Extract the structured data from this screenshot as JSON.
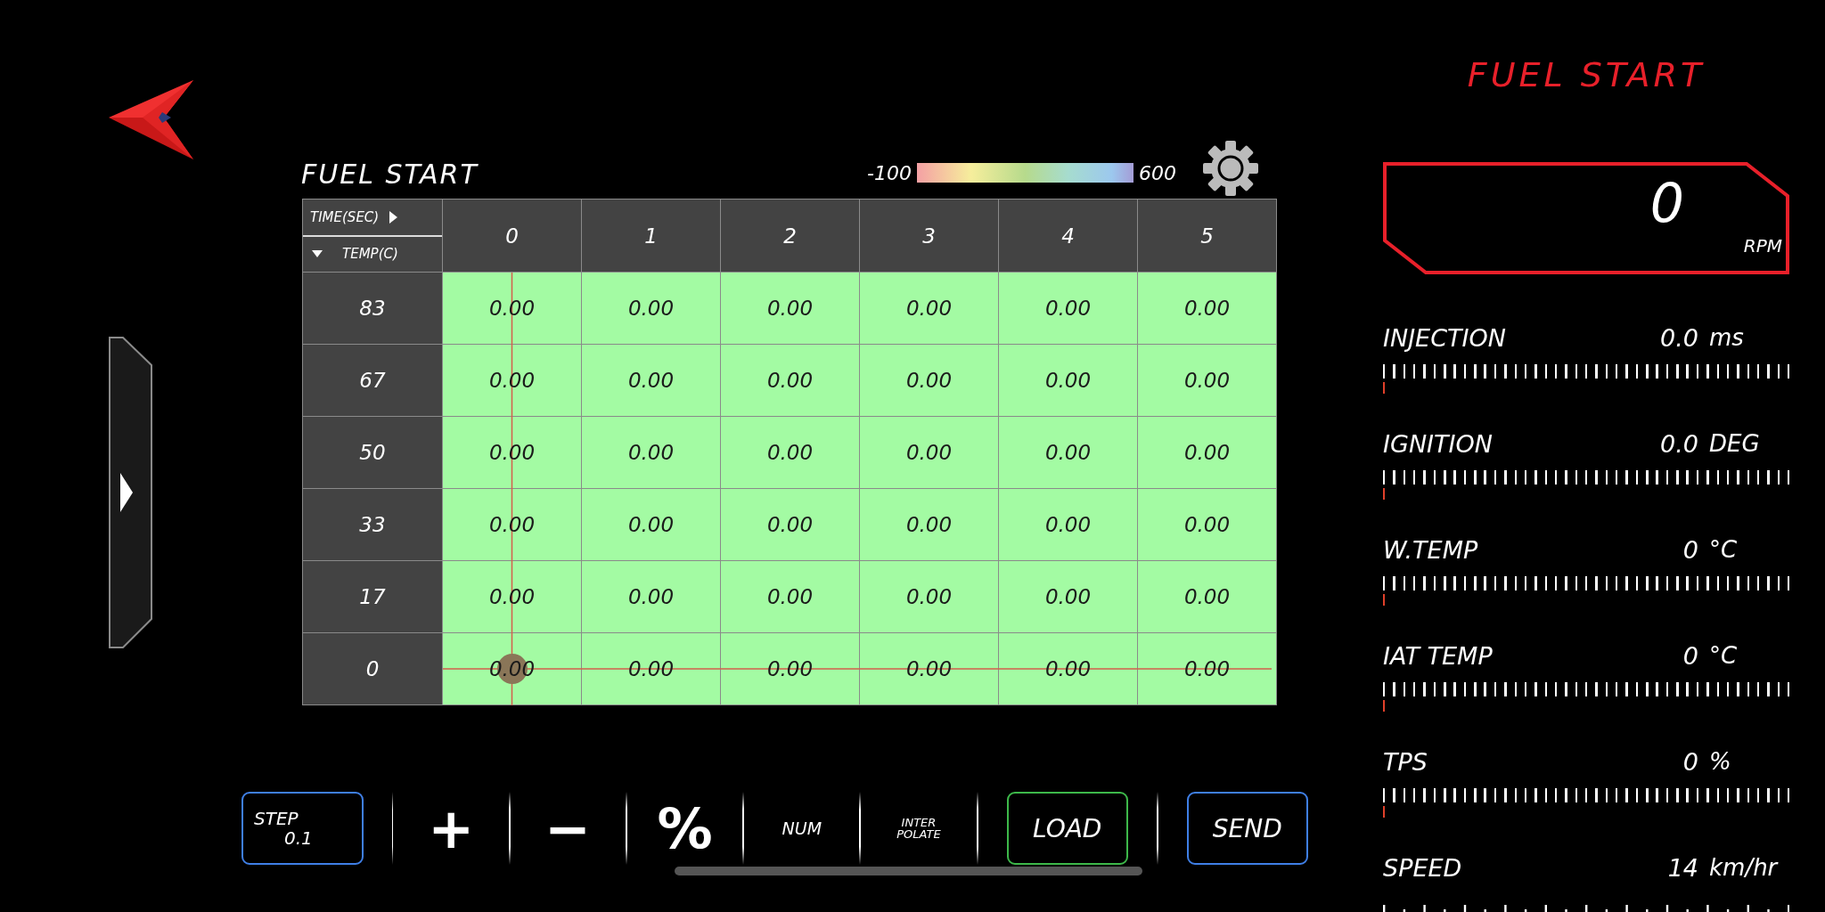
{
  "table": {
    "title": "FUEL START",
    "legend": {
      "min": "-100",
      "max": "600"
    },
    "x_axis_label": "TIME(SEC)",
    "y_axis_label": "TEMP(C)",
    "columns": [
      "0",
      "1",
      "2",
      "3",
      "4",
      "5"
    ],
    "rows": [
      {
        "label": "83",
        "cells": [
          {
            "value": "0.00",
            "selected": false
          },
          {
            "value": "0.00",
            "selected": false
          },
          {
            "value": "0.00",
            "selected": false
          },
          {
            "value": "0.00",
            "selected": false
          },
          {
            "value": "0.00",
            "selected": false
          },
          {
            "value": "0.00",
            "selected": false
          }
        ]
      },
      {
        "label": "67",
        "cells": [
          {
            "value": "0.00",
            "selected": false
          },
          {
            "value": "0.00",
            "selected": false
          },
          {
            "value": "0.00",
            "selected": false
          },
          {
            "value": "0.00",
            "selected": false
          },
          {
            "value": "0.00",
            "selected": false
          },
          {
            "value": "0.00",
            "selected": false
          }
        ]
      },
      {
        "label": "50",
        "cells": [
          {
            "value": "0.00",
            "selected": false
          },
          {
            "value": "0.00",
            "selected": false
          },
          {
            "value": "0.00",
            "selected": false
          },
          {
            "value": "0.00",
            "selected": false
          },
          {
            "value": "0.00",
            "selected": false
          },
          {
            "value": "0.00",
            "selected": false
          }
        ]
      },
      {
        "label": "33",
        "cells": [
          {
            "value": "0.00",
            "selected": false
          },
          {
            "value": "0.00",
            "selected": false
          },
          {
            "value": "0.00",
            "selected": false
          },
          {
            "value": "0.00",
            "selected": false
          },
          {
            "value": "0.00",
            "selected": false
          },
          {
            "value": "0.00",
            "selected": false
          }
        ]
      },
      {
        "label": "17",
        "cells": [
          {
            "value": "0.00",
            "selected": false
          },
          {
            "value": "0.00",
            "selected": false
          },
          {
            "value": "0.00",
            "selected": false
          },
          {
            "value": "0.00",
            "selected": false
          },
          {
            "value": "0.00",
            "selected": false
          },
          {
            "value": "0.00",
            "selected": false
          }
        ]
      },
      {
        "label": "0",
        "cells": [
          {
            "value": "0.00",
            "selected": true
          },
          {
            "value": "0.00",
            "selected": false
          },
          {
            "value": "0.00",
            "selected": false
          },
          {
            "value": "0.00",
            "selected": false
          },
          {
            "value": "0.00",
            "selected": false
          },
          {
            "value": "0.00",
            "selected": false
          }
        ]
      }
    ]
  },
  "toolbar": [
    {
      "kind": "step",
      "label": "STEP",
      "value": "0.1",
      "color": "#3f7fe6"
    },
    {
      "kind": "symbol",
      "label": "+"
    },
    {
      "kind": "symbol",
      "label": "−"
    },
    {
      "kind": "symbol",
      "label": "%"
    },
    {
      "kind": "small",
      "label": "NUM"
    },
    {
      "kind": "tiny",
      "label": "INTER\nPOLATE"
    },
    {
      "kind": "boxed",
      "label": "LOAD",
      "color": "#3db84a"
    },
    {
      "kind": "boxed",
      "label": "SEND",
      "color": "#3f7fe6"
    }
  ],
  "panel": {
    "title": "FUEL START",
    "rpm": {
      "value": "0",
      "unit": "RPM"
    },
    "gauges": [
      {
        "kind": "bar",
        "label": "INJECTION",
        "value": "0.0",
        "unit": "ms",
        "level": 0
      },
      {
        "kind": "bar",
        "label": "IGNITION",
        "value": "0.0",
        "unit": "DEG",
        "level": 0
      },
      {
        "kind": "bar",
        "label": "W.TEMP",
        "value": "0",
        "unit": "°C",
        "level": 0
      },
      {
        "kind": "bar",
        "label": "IAT TEMP",
        "value": "0",
        "unit": "°C",
        "level": 0
      },
      {
        "kind": "bar",
        "label": "TPS",
        "value": "0",
        "unit": "%",
        "level": 0
      },
      {
        "kind": "dots",
        "label": "SPEED",
        "value": "14",
        "unit": "km/hr"
      }
    ]
  }
}
